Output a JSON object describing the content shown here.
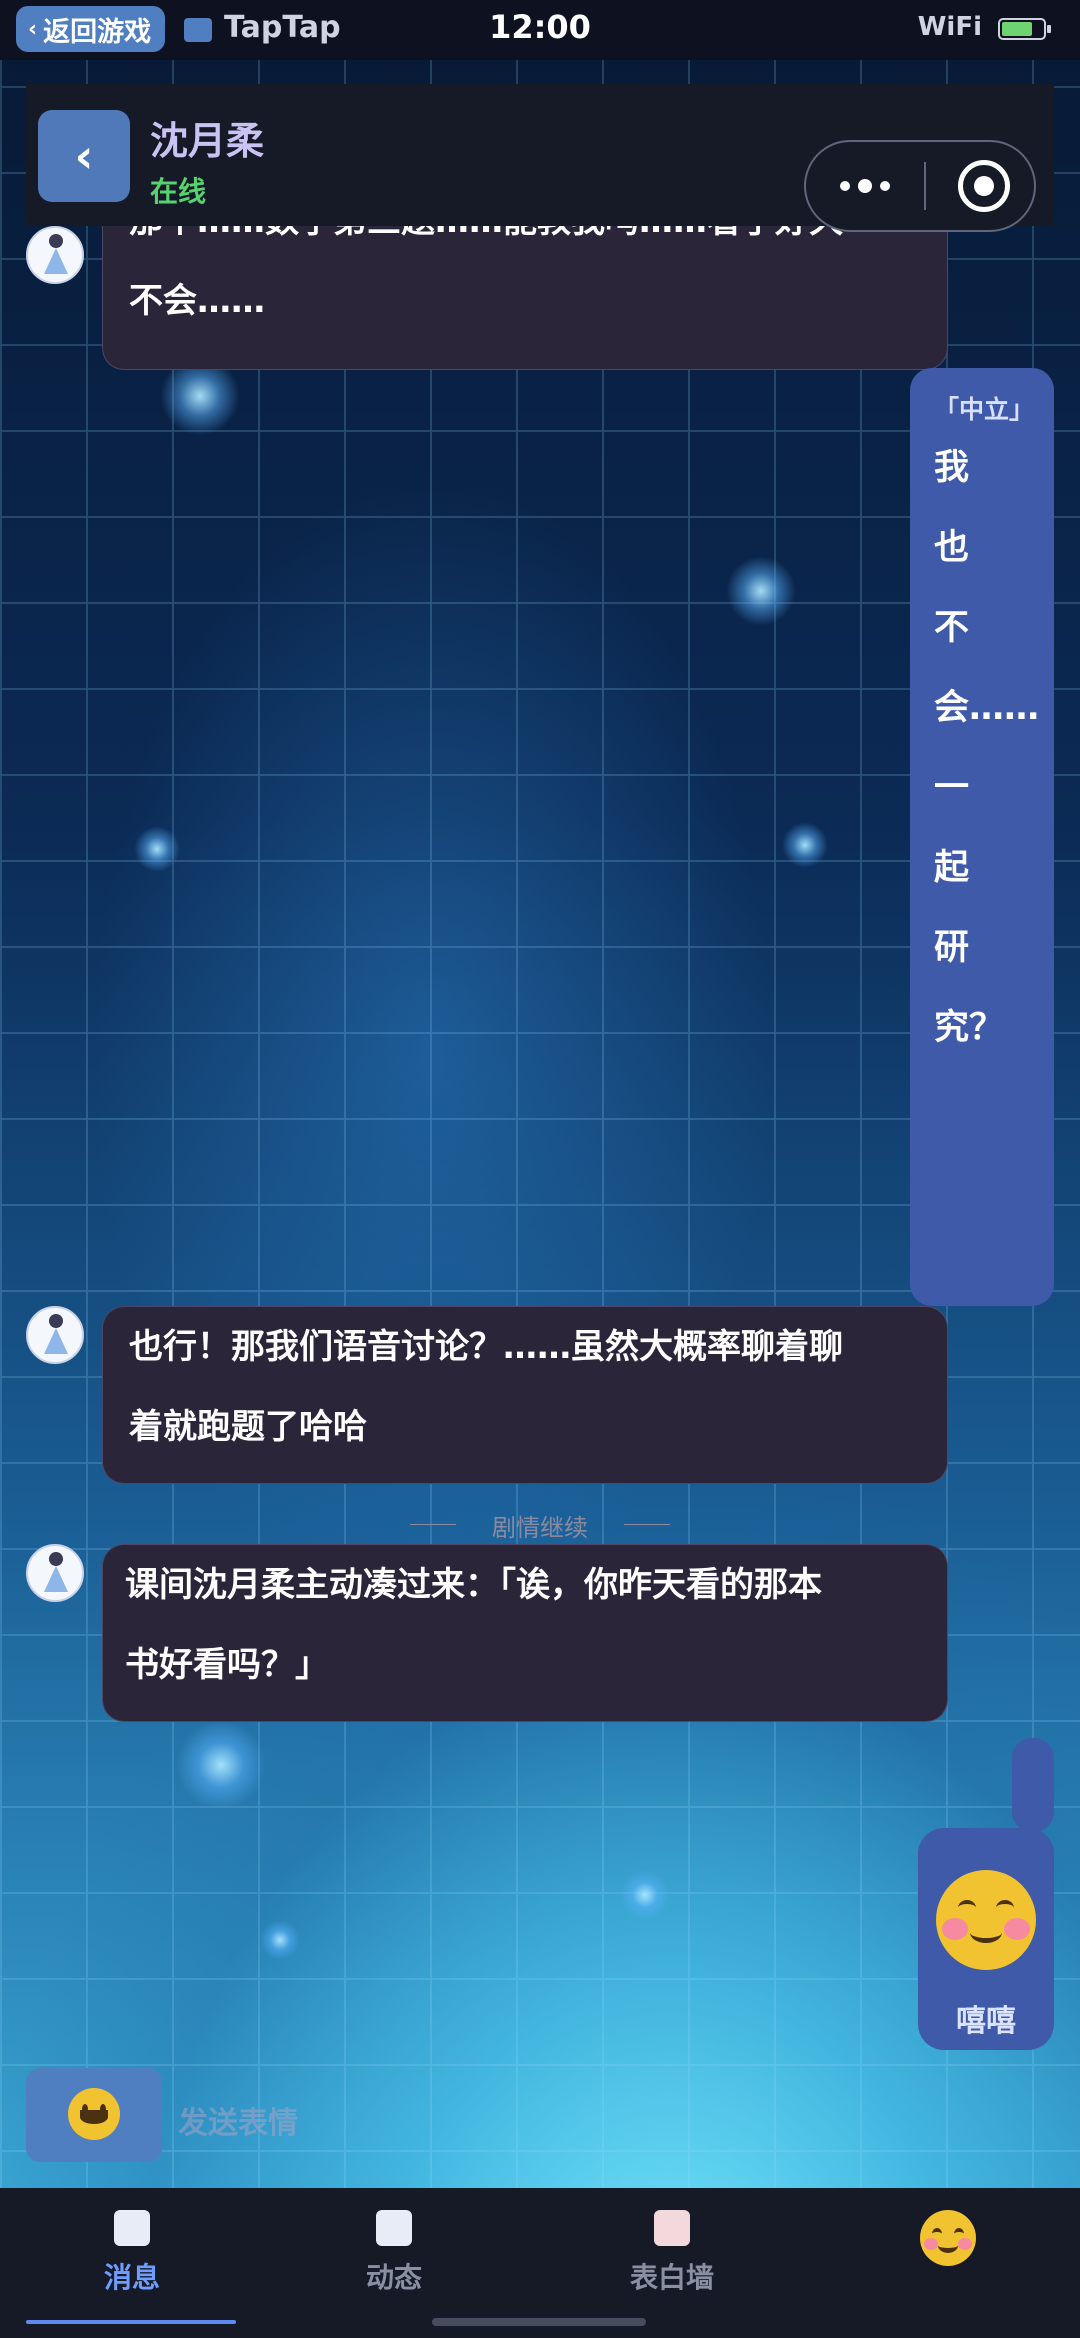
{
  "status_bar": {
    "back_label": "返回游戏",
    "carrier": "TapTap",
    "time": "12:00",
    "network": "WiFi"
  },
  "header": {
    "contact_name": "沈月柔",
    "contact_status": "在线"
  },
  "messages": [
    {
      "line1": "那个……数学第三题……能教我吗……看了好久",
      "line2": "不会……"
    },
    {
      "tag": "「中立」",
      "text": "我也不会……一起研究？"
    },
    {
      "line1": "也行！那我们语音讨论？……虽然大概率聊着聊",
      "line2": "着就跑题了哈哈"
    },
    {
      "line1": "课间沈月柔主动凑过来：「诶，你昨天看的那本",
      "line2": "书好看吗？」"
    }
  ],
  "divider": "剧情继续",
  "floating_emoji": {
    "label": "嘻嘻",
    "icon": "smiling-face-icon"
  },
  "input": {
    "emoji_icon": "grinning-face-icon",
    "placeholder": "发送表情"
  },
  "tabs": [
    {
      "label": "消息",
      "active": true
    },
    {
      "label": "动态",
      "active": false
    },
    {
      "label": "表白墙",
      "active": false
    }
  ],
  "colors": {
    "accent_blue": "#4f7fc0",
    "bubble_dark": "#2a2539",
    "bubble_blue": "#3f5aa8",
    "online_green": "#56d36e",
    "active_tab": "#6f9cff"
  }
}
